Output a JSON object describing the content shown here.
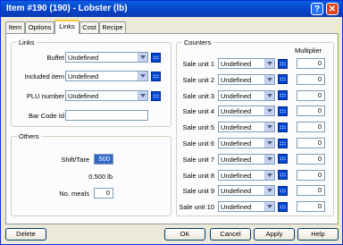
{
  "window": {
    "title": "Item #190 (190) - Lobster (lb)",
    "help_glyph": "?",
    "close_glyph": "✕"
  },
  "tabs": [
    {
      "label": "Item",
      "active": false
    },
    {
      "label": "Options",
      "active": false
    },
    {
      "label": "Links",
      "active": true
    },
    {
      "label": "Cost",
      "active": false
    },
    {
      "label": "Recipe",
      "active": false
    }
  ],
  "links": {
    "legend": "Links",
    "buffet": {
      "label": "Buffet",
      "value": "Undefined"
    },
    "included_item": {
      "label": "Included item",
      "value": "Undefined"
    },
    "plu_number": {
      "label": "PLU number",
      "value": "Undefined"
    },
    "bar_code": {
      "label": "Bar Code Id",
      "value": ""
    }
  },
  "others": {
    "legend": "Others",
    "shift_tare": {
      "label": "Shift/Tare",
      "value": "500"
    },
    "weight_text": "0.500 lb",
    "no_meals": {
      "label": "No. meals",
      "value": "0"
    }
  },
  "counters": {
    "legend": "Counters",
    "multiplier_header": "Multiplier",
    "rows": [
      {
        "label": "Sale unit 1",
        "value": "Undefined",
        "multiplier": "0"
      },
      {
        "label": "Sale unit 2",
        "value": "Undefined",
        "multiplier": "0"
      },
      {
        "label": "Sale unit 3",
        "value": "Undefined",
        "multiplier": "0"
      },
      {
        "label": "Sale unit 4",
        "value": "Undefined",
        "multiplier": "0"
      },
      {
        "label": "Sale unit 5",
        "value": "Undefined",
        "multiplier": "0"
      },
      {
        "label": "Sale unit 6",
        "value": "Undefined",
        "multiplier": "0"
      },
      {
        "label": "Sale unit 7",
        "value": "Undefined",
        "multiplier": "0"
      },
      {
        "label": "Sale unit 8",
        "value": "Undefined",
        "multiplier": "0"
      },
      {
        "label": "Sale unit 9",
        "value": "Undefined",
        "multiplier": "0"
      },
      {
        "label": "Sale unit 10",
        "value": "Undefined",
        "multiplier": "0"
      }
    ]
  },
  "buttons": {
    "delete": "Delete",
    "ok": "OK",
    "cancel": "Cancel",
    "apply": "Apply",
    "help": "Help"
  }
}
